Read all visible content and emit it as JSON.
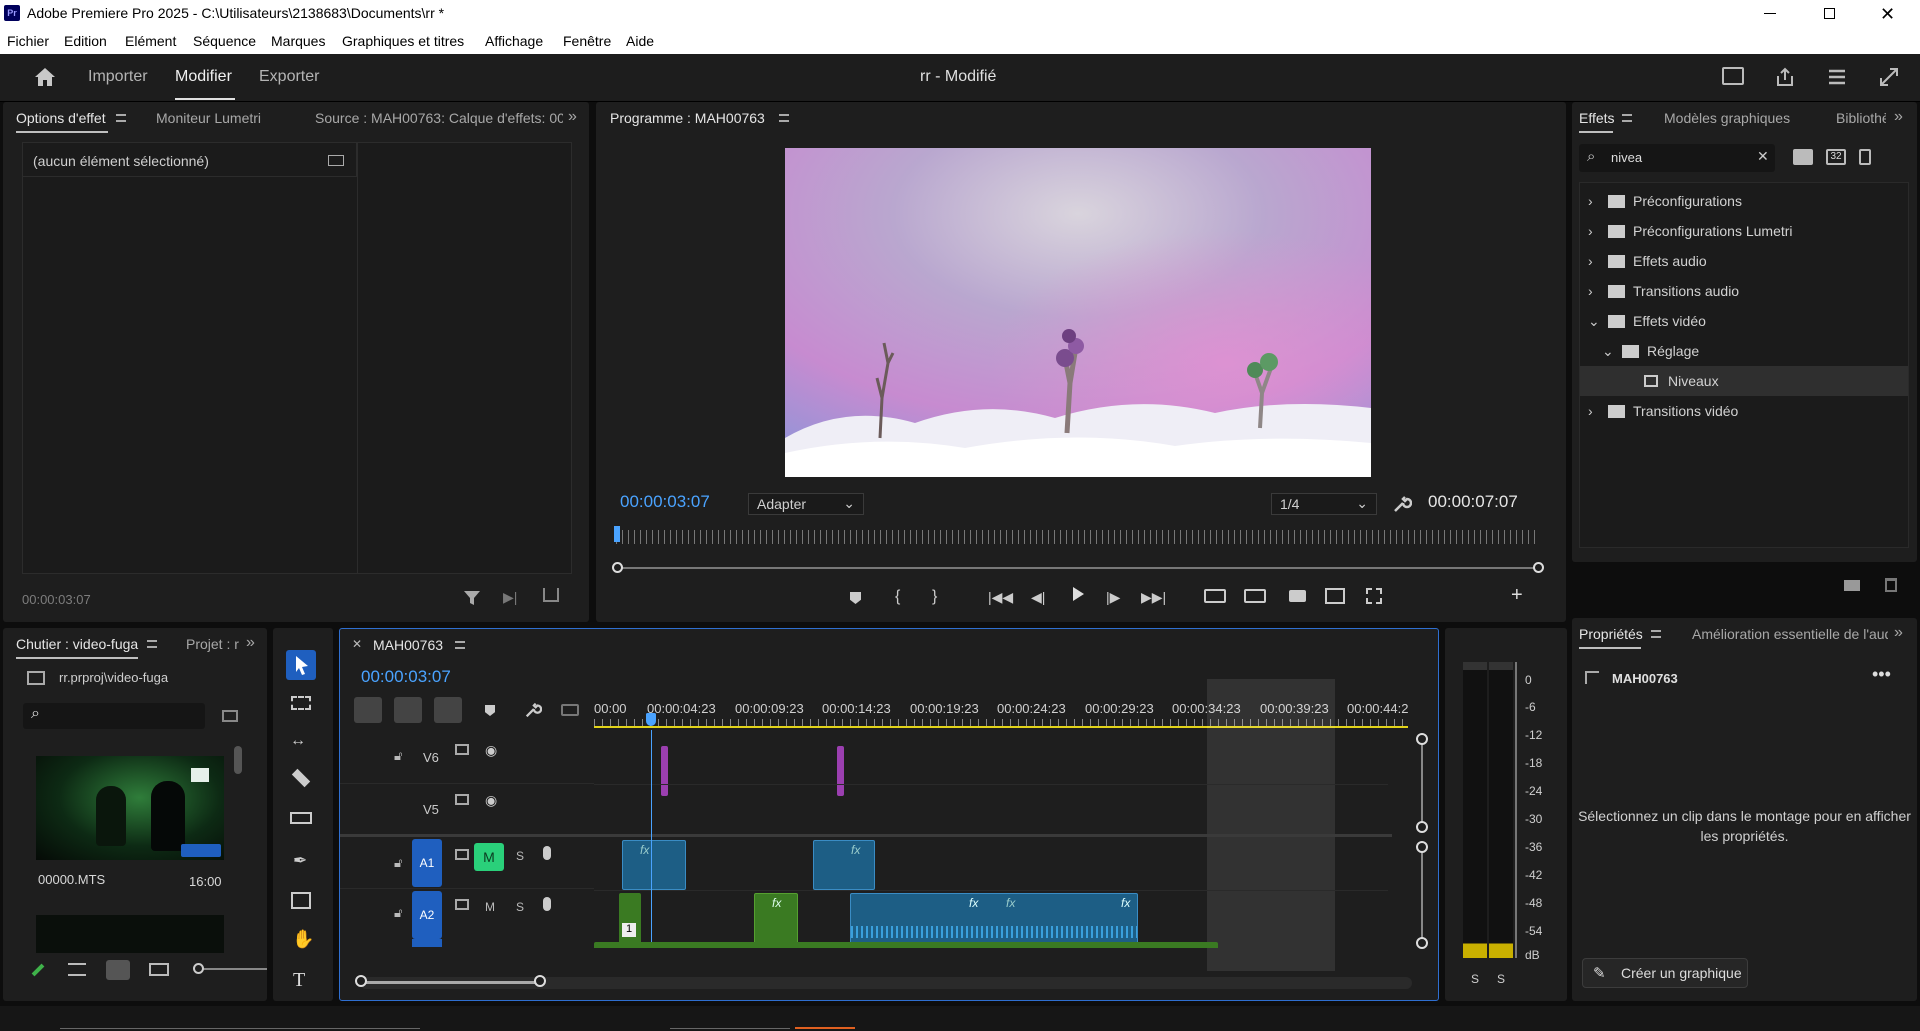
{
  "titlebar": {
    "text": "Adobe Premiere Pro 2025 - C:\\Utilisateurs\\2138683\\Documents\\rr *",
    "app_icon": "Pr"
  },
  "menu": [
    "Fichier",
    "Edition",
    "Elément",
    "Séquence",
    "Marques",
    "Graphiques et titres",
    "Affichage",
    "Fenêtre",
    "Aide"
  ],
  "workspace": {
    "tabs": [
      "Importer",
      "Modifier",
      "Exporter"
    ],
    "active": "Modifier",
    "project_title": "rr - Modifié"
  },
  "effect_options": {
    "tabs": [
      "Options d'effet",
      "Moniteur Lumetri",
      "Source : MAH00763: Calque d'effets: 00:("
    ],
    "empty_label": "(aucun élément sélectionné)",
    "timecode": "00:00:03:07"
  },
  "program": {
    "title": "Programme : MAH00763",
    "timecode": "00:00:03:07",
    "fit": "Adapter",
    "resolution": "1/4",
    "duration": "00:00:07:07",
    "playhead_fraction": 0.005
  },
  "effects_panel": {
    "tabs": [
      "Effets",
      "Modèles graphiques",
      "Bibliothè"
    ],
    "search_value": "nivea",
    "badge": "32",
    "tree": [
      {
        "label": "Préconfigurations",
        "level": 0,
        "expanded": false
      },
      {
        "label": "Préconfigurations Lumetri",
        "level": 0,
        "expanded": false
      },
      {
        "label": "Effets audio",
        "level": 0,
        "expanded": false
      },
      {
        "label": "Transitions audio",
        "level": 0,
        "expanded": false
      },
      {
        "label": "Effets vidéo",
        "level": 0,
        "expanded": true
      },
      {
        "label": "Réglage",
        "level": 1,
        "expanded": true
      },
      {
        "label": "Niveaux",
        "level": 2,
        "selected": true
      },
      {
        "label": "Transitions vidéo",
        "level": 0,
        "expanded": false
      }
    ]
  },
  "bin": {
    "tabs": [
      "Chutier : video-fuga",
      "Projet : r"
    ],
    "path": "rr.prproj\\video-fuga",
    "clip_name": "00000.MTS",
    "clip_duration": "16:00"
  },
  "timeline": {
    "sequence": "MAH00763",
    "timecode": "00:00:03:07",
    "ruler": [
      "00:00",
      "00:00:04:23",
      "00:00:09:23",
      "00:00:14:23",
      "00:00:19:23",
      "00:00:24:23",
      "00:00:29:23",
      "00:00:34:23",
      "00:00:39:23",
      "00:00:44:2"
    ],
    "tracks": [
      {
        "label": "V6",
        "type": "video"
      },
      {
        "label": "V5",
        "type": "video"
      },
      {
        "label": "A1",
        "type": "audio",
        "source": "A1",
        "mute": "M",
        "solo": "S",
        "mute_on": true
      },
      {
        "label": "A2",
        "type": "audio",
        "source": "A2",
        "mute": "M",
        "solo": "S",
        "mute_on": false
      }
    ],
    "clip_badge": "1",
    "fx": "fx"
  },
  "meter": {
    "labels": [
      "0",
      "-6",
      "-12",
      "-18",
      "-24",
      "-30",
      "-36",
      "-42",
      "-48",
      "-54",
      "dB"
    ],
    "solo": [
      "S",
      "S"
    ]
  },
  "properties": {
    "tabs": [
      "Propriétés",
      "Amélioration essentielle de l'aud"
    ],
    "clip": "MAH00763",
    "message": "Sélectionnez un clip dans le montage pour en afficher les propriétés.",
    "create_button": "Créer un graphique"
  },
  "colors": {
    "accent": "#4aa3ff",
    "track_blue": "#1f5fbf",
    "audio_clip": "#1d5e85",
    "video_clip": "#3a7a22",
    "purple": "#9b3fb0",
    "yellow": "#e2d31a"
  }
}
